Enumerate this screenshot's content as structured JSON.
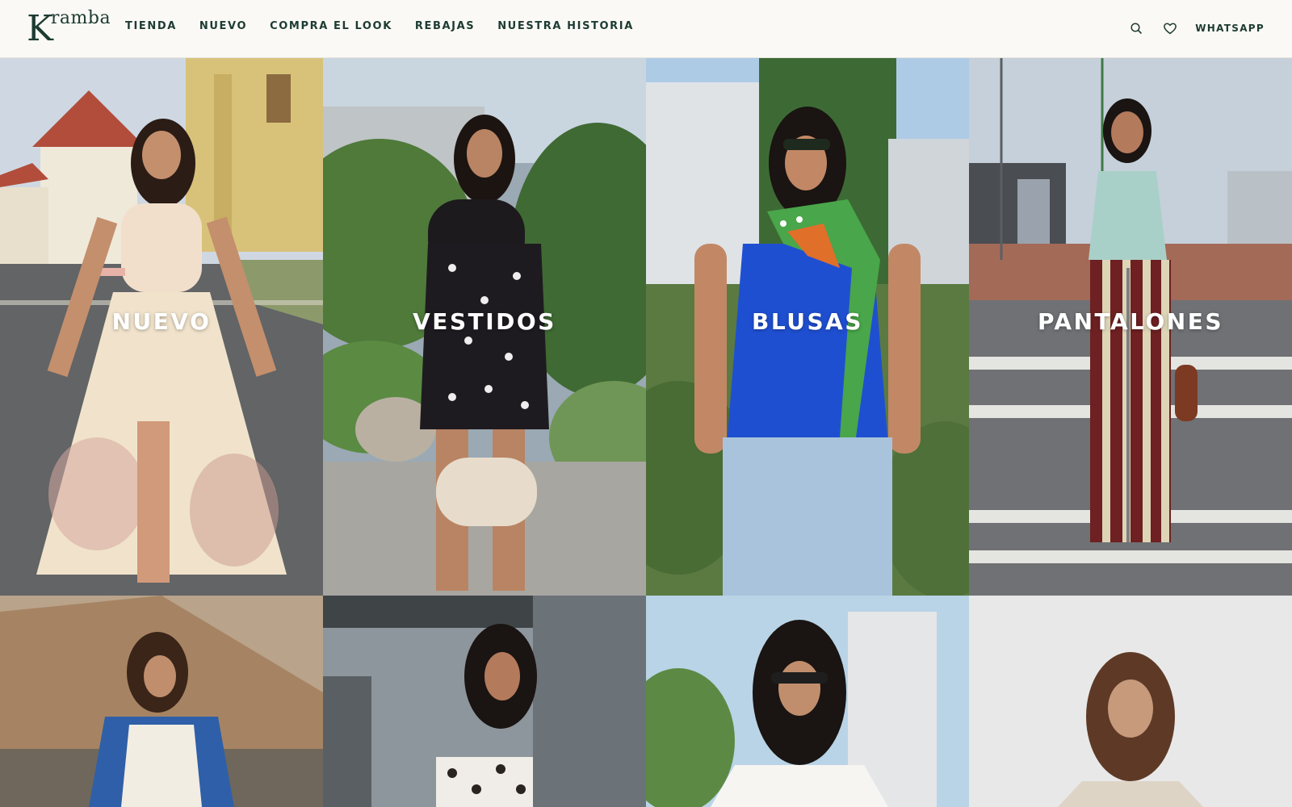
{
  "brand": {
    "logo_initial": "K",
    "logo_rest": "ramba"
  },
  "nav": {
    "items": [
      {
        "label": "TIENDA"
      },
      {
        "label": "NUEVO"
      },
      {
        "label": "COMPRA EL LOOK"
      },
      {
        "label": "REBAJAS"
      },
      {
        "label": "NUESTRA HISTORIA"
      }
    ]
  },
  "tools": {
    "whatsapp_label": "WHATSAPP",
    "search_icon": "search-icon",
    "wishlist_icon": "heart-icon"
  },
  "categories": [
    {
      "label": "NUEVO"
    },
    {
      "label": "VESTIDOS"
    },
    {
      "label": "BLUSAS"
    },
    {
      "label": "PANTALONES"
    }
  ],
  "colors": {
    "brand_text": "#1d3b32",
    "header_bg": "#faf9f5"
  }
}
